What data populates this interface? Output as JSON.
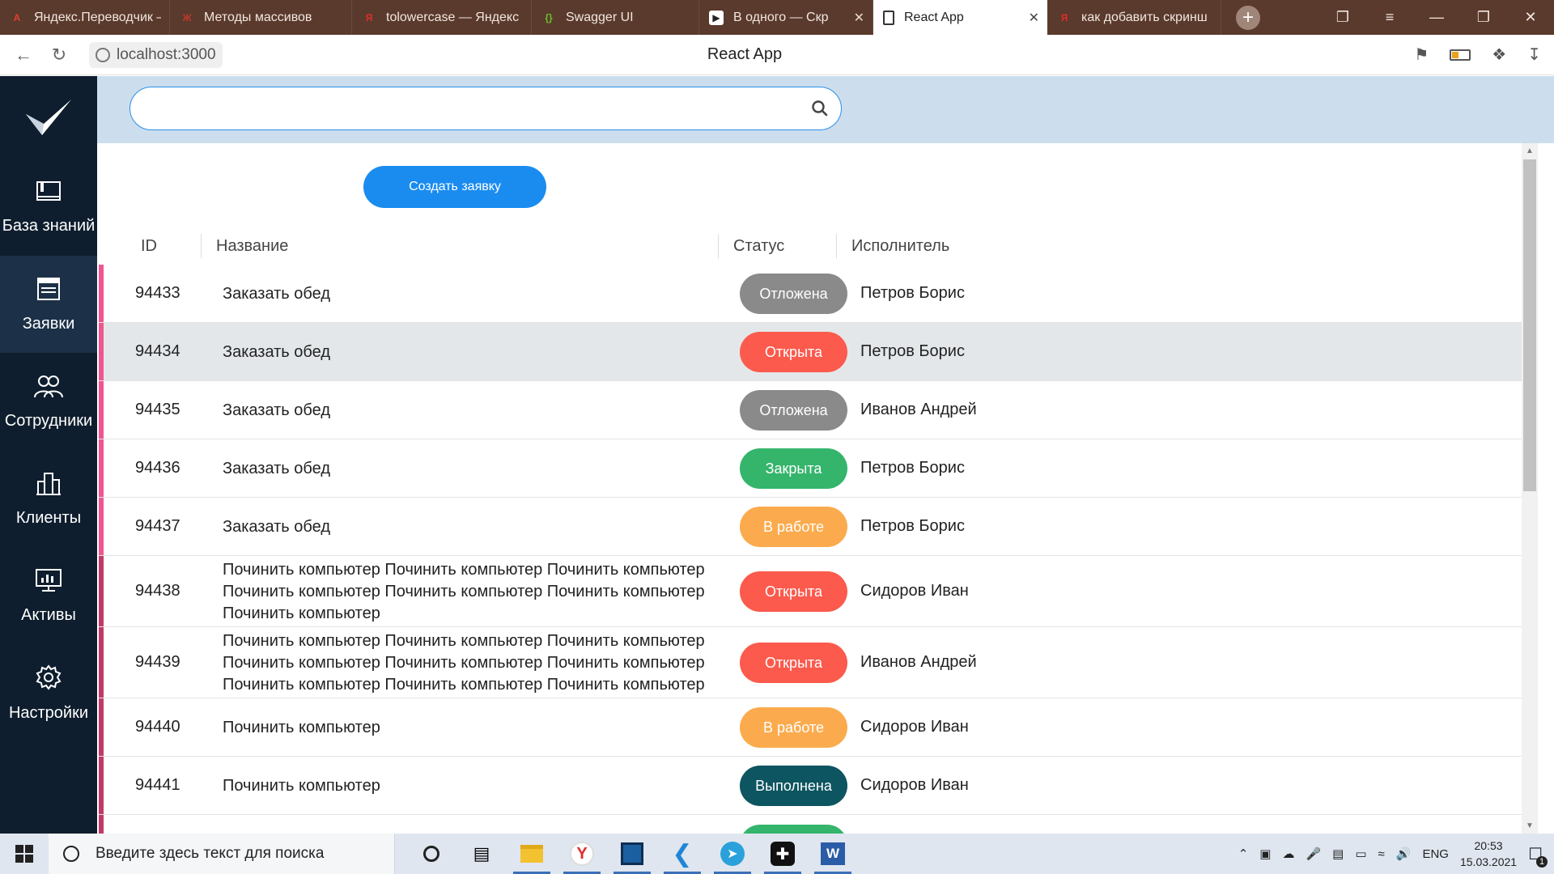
{
  "browser": {
    "tabs": [
      {
        "title": "Яндекс.Переводчик –",
        "icon": "yandex-translate-icon",
        "color": "#e23f2f",
        "glyph": "A"
      },
      {
        "title": "Методы массивов",
        "icon": "tutorial-icon",
        "color": "#c0392b",
        "glyph": "Ж"
      },
      {
        "title": "tolowercase — Яндекс",
        "icon": "yandex-icon",
        "color": "#e02d2d",
        "glyph": "Я"
      },
      {
        "title": "Swagger UI",
        "icon": "swagger-icon",
        "color": "#6cbf2f",
        "glyph": "{}"
      },
      {
        "title": "В одного — Скр",
        "icon": "play-icon",
        "color": "#ffffff",
        "glyph": "▶"
      },
      {
        "title": "React App",
        "icon": "page-icon",
        "color": "#ffffff",
        "glyph": ""
      },
      {
        "title": "как добавить скринш",
        "icon": "yandex-icon",
        "color": "#e02d2d",
        "glyph": "Я"
      }
    ],
    "active_tab": 5,
    "url": "localhost:3000",
    "page_title": "React App"
  },
  "sidebar": {
    "items": [
      {
        "label": "База знаний",
        "icon": "book-icon"
      },
      {
        "label": "Заявки",
        "icon": "document-icon"
      },
      {
        "label": "Сотрудники",
        "icon": "users-icon"
      },
      {
        "label": "Клиенты",
        "icon": "building-icon"
      },
      {
        "label": "Активы",
        "icon": "monitor-icon"
      },
      {
        "label": "Настройки",
        "icon": "gear-icon"
      }
    ],
    "active": 1
  },
  "search": {
    "placeholder": "",
    "value": ""
  },
  "toolbar": {
    "create_label": "Создать заявку"
  },
  "table": {
    "columns": [
      "ID",
      "Название",
      "Статус",
      "Исполнитель"
    ],
    "rows": [
      {
        "id": "94433",
        "name": [
          "Заказать обед"
        ],
        "status": "Отложена",
        "status_color": "#8a8a8a",
        "executor": "Петров Борис",
        "priority_color": "#f0568f"
      },
      {
        "id": "94434",
        "name": [
          "Заказать обед"
        ],
        "status": "Открыта",
        "status_color": "#fb5a4d",
        "executor": "Петров Борис",
        "priority_color": "#f0568f",
        "highlighted": true
      },
      {
        "id": "94435",
        "name": [
          "Заказать обед"
        ],
        "status": "Отложена",
        "status_color": "#8a8a8a",
        "executor": "Иванов Андрей",
        "priority_color": "#f0568f"
      },
      {
        "id": "94436",
        "name": [
          "Заказать обед"
        ],
        "status": "Закрыта",
        "status_color": "#34b56b",
        "executor": "Петров Борис",
        "priority_color": "#f0568f"
      },
      {
        "id": "94437",
        "name": [
          "Заказать обед"
        ],
        "status": "В работе",
        "status_color": "#fbab4d",
        "executor": "Петров Борис",
        "priority_color": "#f0568f"
      },
      {
        "id": "94438",
        "name": [
          "Починить компьютер Починить компьютер Починить компьютер",
          "Починить компьютер Починить компьютер Починить компьютер",
          "Починить компьютер"
        ],
        "status": "Открыта",
        "status_color": "#fb5a4d",
        "executor": "Сидоров Иван",
        "priority_color": "#c23a66"
      },
      {
        "id": "94439",
        "name": [
          "Починить компьютер Починить компьютер Починить компьютер",
          "Починить компьютер Починить компьютер Починить компьютер",
          "Починить компьютер Починить компьютер Починить компьютер"
        ],
        "status": "Открыта",
        "status_color": "#fb5a4d",
        "executor": "Иванов Андрей",
        "priority_color": "#c23a66"
      },
      {
        "id": "94440",
        "name": [
          "Починить компьютер"
        ],
        "status": "В работе",
        "status_color": "#fbab4d",
        "executor": "Сидоров Иван",
        "priority_color": "#c23a66"
      },
      {
        "id": "94441",
        "name": [
          "Починить компьютер"
        ],
        "status": "Выполнена",
        "status_color": "#0d5560",
        "executor": "Сидоров Иван",
        "priority_color": "#c23a66"
      }
    ]
  },
  "taskbar": {
    "search_placeholder": "Введите здесь текст для поиска",
    "language": "ENG",
    "time": "20:53",
    "date": "15.03.2021",
    "notifications": "1"
  }
}
